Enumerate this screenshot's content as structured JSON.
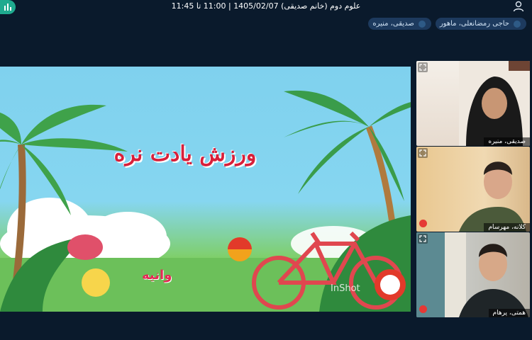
{
  "header": {
    "title": "علوم دوم (خانم صدیقی) 1405/02/07 | 11:00 تا 11:45"
  },
  "participants_chips": [
    {
      "label": "حاجی رمضانعلی، ماهور"
    },
    {
      "label": "صدیقی، منیره"
    }
  ],
  "shared_content": {
    "banner_text": "ورزش یادت نره",
    "small_label": "وانیه",
    "watermark": "InShot"
  },
  "video_tiles": [
    {
      "name": "صدیقی، منیره",
      "muted": false
    },
    {
      "name": "کلانه، مهرسام",
      "muted": true
    },
    {
      "name": "همتی، پرهام",
      "muted": true
    }
  ],
  "colors": {
    "background": "#0a1a2c",
    "chip_bg": "#1d3a5e",
    "accent": "#1faa8f",
    "muted_red": "#e53935"
  }
}
